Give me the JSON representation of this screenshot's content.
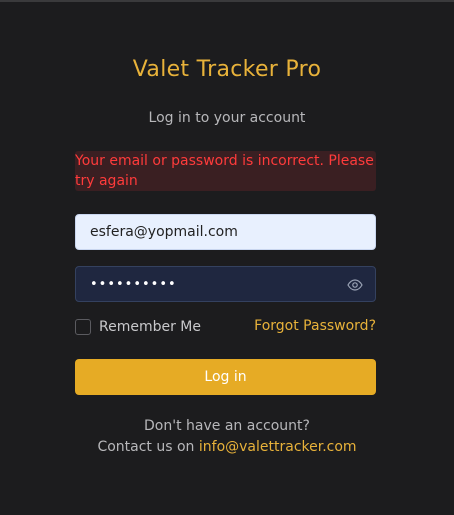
{
  "app": {
    "title": "Valet Tracker Pro",
    "subtitle": "Log in to your account"
  },
  "error": {
    "message": "Your email or password is incorrect. Please try again"
  },
  "form": {
    "email_value": "esfera@yopmail.com",
    "password_value": "••••••••••",
    "remember_label": "Remember Me",
    "forgot_label": "Forgot Password?",
    "login_label": "Log in"
  },
  "footer": {
    "no_account": "Don't have an account?",
    "contact_prefix": "Contact us on",
    "contact_email": "info@valettracker.com"
  },
  "icons": {
    "password_toggle": "eye-icon"
  },
  "colors": {
    "background": "#1c1c1e",
    "accent": "#e8b23a",
    "error_text": "#ff3b3b",
    "error_background": "#3a1f22",
    "button": "#e6ab25"
  }
}
